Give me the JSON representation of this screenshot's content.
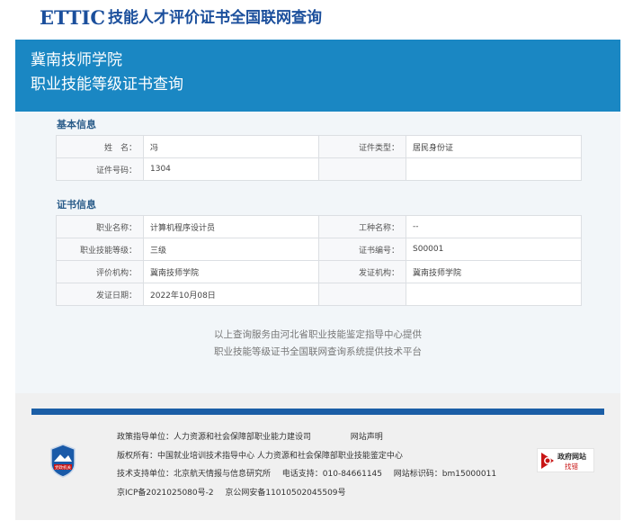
{
  "brand": {
    "logo_text": "ETTIC",
    "site_title": "技能人才评价证书全国联网查询"
  },
  "header": {
    "school": "冀南技师学院",
    "title": "职业技能等级证书查询"
  },
  "basic": {
    "label": "基本信息",
    "name_label": "姓　名：",
    "name_value": "冯",
    "id_type_label": "证件类型：",
    "id_type_value": "居民身份证",
    "id_no_label": "证件号码：",
    "id_no_value": "1304"
  },
  "cert": {
    "label": "证书信息",
    "occupation_label": "职业名称：",
    "occupation_value": "计算机程序设计员",
    "work_type_label": "工种名称：",
    "work_type_value": "--",
    "level_label": "职业技能等级：",
    "level_value": "三级",
    "cert_no_label": "证书编号：",
    "cert_no_value": "S00001",
    "evaluator_label": "评价机构：",
    "evaluator_value": "冀南技师学院",
    "issuer_label": "发证机构：",
    "issuer_value": "冀南技师学院",
    "date_label": "发证日期：",
    "date_value": "2022年10月08日"
  },
  "notice": {
    "line1": "以上查询服务由河北省职业技能鉴定指导中心提供",
    "line2": "职业技能等级证书全国联网查询系统提供技术平台"
  },
  "footer": {
    "policy": "政策指导单位：人力资源和社会保障部职业能力建设司",
    "statement_link": "网站声明",
    "copyright": "版权所有：中国就业培训技术指导中心 人力资源和社会保障部职业技能鉴定中心",
    "support": "技术支持单位：北京航天情报与信息研究所",
    "phone": "电话支持：010-84661145",
    "site_code": "网站标识码：bm15000011",
    "icp": "京ICP备2021025080号-2",
    "police": "京公网安备11010502045509号",
    "emblem_text": "党政机关",
    "gov_badge_line1": "政府网站",
    "gov_badge_line2": "找错"
  },
  "colors": {
    "brand_blue": "#1b4f9c",
    "header_blue": "#1a87c3",
    "footer_bar": "#1b5ea6",
    "badge_red": "#c81414"
  }
}
